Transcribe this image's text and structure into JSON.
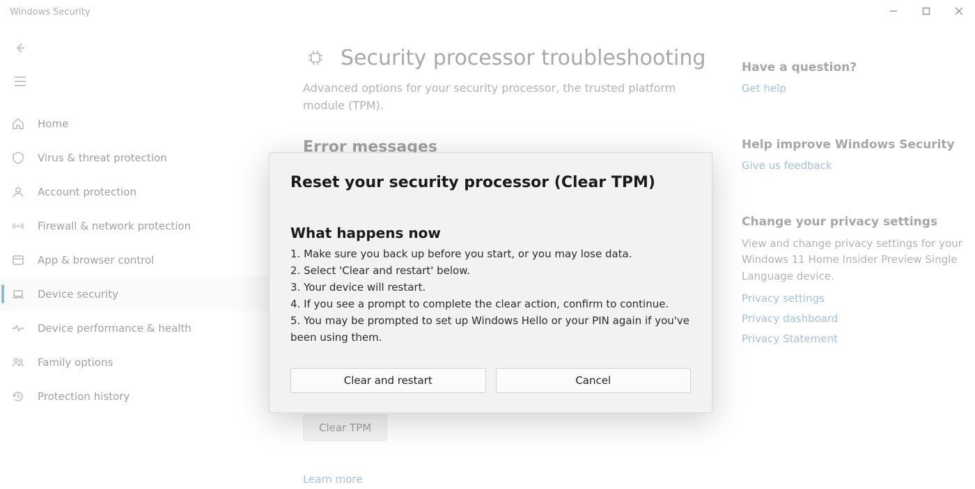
{
  "window": {
    "title": "Windows Security"
  },
  "sidebar": {
    "items": [
      {
        "label": "Home"
      },
      {
        "label": "Virus & threat protection"
      },
      {
        "label": "Account protection"
      },
      {
        "label": "Firewall & network protection"
      },
      {
        "label": "App & browser control"
      },
      {
        "label": "Device security"
      },
      {
        "label": "Device performance & health"
      },
      {
        "label": "Family options"
      },
      {
        "label": "Protection history"
      }
    ]
  },
  "page": {
    "heading": "Security processor troubleshooting",
    "sub": "Advanced options for your security processor, the trusted platform module (TPM).",
    "error_heading": "Error messages",
    "clear_tpm_label": "Clear TPM",
    "learn_more_label": "Learn more"
  },
  "right": {
    "q_heading": "Have a question?",
    "get_help": "Get help",
    "improve_heading": "Help improve Windows Security",
    "feedback": "Give us feedback",
    "privacy_heading": "Change your privacy settings",
    "privacy_text": "View and change privacy settings for your Windows 11 Home Insider Preview Single Language device.",
    "link_settings": "Privacy settings",
    "link_dashboard": "Privacy dashboard",
    "link_statement": "Privacy Statement"
  },
  "modal": {
    "title": "Reset your security processor (Clear TPM)",
    "section": "What happens now",
    "body": "1. Make sure you back up before you start, or you may lose data.\n2. Select 'Clear and restart' below.\n3. Your device will restart.\n4. If you see a prompt to complete the clear action, confirm to continue.\n5. You may be prompted to set up Windows Hello or your PIN again if you've been using them.",
    "primary": "Clear and restart",
    "secondary": "Cancel"
  }
}
